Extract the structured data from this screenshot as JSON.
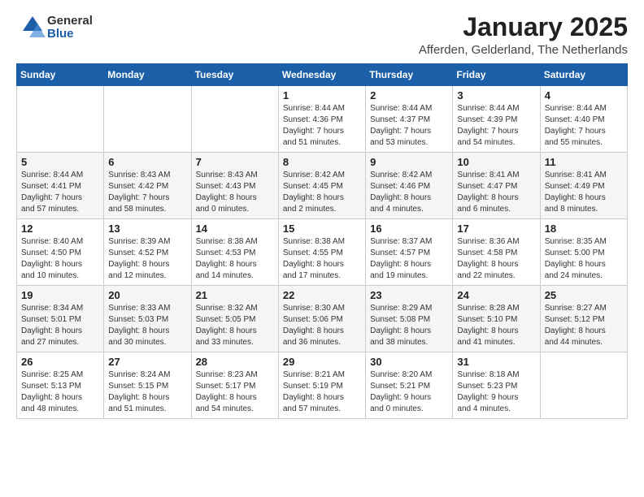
{
  "header": {
    "logo_general": "General",
    "logo_blue": "Blue",
    "title": "January 2025",
    "subtitle": "Afferden, Gelderland, The Netherlands"
  },
  "days_of_week": [
    "Sunday",
    "Monday",
    "Tuesday",
    "Wednesday",
    "Thursday",
    "Friday",
    "Saturday"
  ],
  "weeks": [
    {
      "alt": false,
      "days": [
        {
          "num": "",
          "info": ""
        },
        {
          "num": "",
          "info": ""
        },
        {
          "num": "",
          "info": ""
        },
        {
          "num": "1",
          "info": "Sunrise: 8:44 AM\nSunset: 4:36 PM\nDaylight: 7 hours\nand 51 minutes."
        },
        {
          "num": "2",
          "info": "Sunrise: 8:44 AM\nSunset: 4:37 PM\nDaylight: 7 hours\nand 53 minutes."
        },
        {
          "num": "3",
          "info": "Sunrise: 8:44 AM\nSunset: 4:39 PM\nDaylight: 7 hours\nand 54 minutes."
        },
        {
          "num": "4",
          "info": "Sunrise: 8:44 AM\nSunset: 4:40 PM\nDaylight: 7 hours\nand 55 minutes."
        }
      ]
    },
    {
      "alt": true,
      "days": [
        {
          "num": "5",
          "info": "Sunrise: 8:44 AM\nSunset: 4:41 PM\nDaylight: 7 hours\nand 57 minutes."
        },
        {
          "num": "6",
          "info": "Sunrise: 8:43 AM\nSunset: 4:42 PM\nDaylight: 7 hours\nand 58 minutes."
        },
        {
          "num": "7",
          "info": "Sunrise: 8:43 AM\nSunset: 4:43 PM\nDaylight: 8 hours\nand 0 minutes."
        },
        {
          "num": "8",
          "info": "Sunrise: 8:42 AM\nSunset: 4:45 PM\nDaylight: 8 hours\nand 2 minutes."
        },
        {
          "num": "9",
          "info": "Sunrise: 8:42 AM\nSunset: 4:46 PM\nDaylight: 8 hours\nand 4 minutes."
        },
        {
          "num": "10",
          "info": "Sunrise: 8:41 AM\nSunset: 4:47 PM\nDaylight: 8 hours\nand 6 minutes."
        },
        {
          "num": "11",
          "info": "Sunrise: 8:41 AM\nSunset: 4:49 PM\nDaylight: 8 hours\nand 8 minutes."
        }
      ]
    },
    {
      "alt": false,
      "days": [
        {
          "num": "12",
          "info": "Sunrise: 8:40 AM\nSunset: 4:50 PM\nDaylight: 8 hours\nand 10 minutes."
        },
        {
          "num": "13",
          "info": "Sunrise: 8:39 AM\nSunset: 4:52 PM\nDaylight: 8 hours\nand 12 minutes."
        },
        {
          "num": "14",
          "info": "Sunrise: 8:38 AM\nSunset: 4:53 PM\nDaylight: 8 hours\nand 14 minutes."
        },
        {
          "num": "15",
          "info": "Sunrise: 8:38 AM\nSunset: 4:55 PM\nDaylight: 8 hours\nand 17 minutes."
        },
        {
          "num": "16",
          "info": "Sunrise: 8:37 AM\nSunset: 4:57 PM\nDaylight: 8 hours\nand 19 minutes."
        },
        {
          "num": "17",
          "info": "Sunrise: 8:36 AM\nSunset: 4:58 PM\nDaylight: 8 hours\nand 22 minutes."
        },
        {
          "num": "18",
          "info": "Sunrise: 8:35 AM\nSunset: 5:00 PM\nDaylight: 8 hours\nand 24 minutes."
        }
      ]
    },
    {
      "alt": true,
      "days": [
        {
          "num": "19",
          "info": "Sunrise: 8:34 AM\nSunset: 5:01 PM\nDaylight: 8 hours\nand 27 minutes."
        },
        {
          "num": "20",
          "info": "Sunrise: 8:33 AM\nSunset: 5:03 PM\nDaylight: 8 hours\nand 30 minutes."
        },
        {
          "num": "21",
          "info": "Sunrise: 8:32 AM\nSunset: 5:05 PM\nDaylight: 8 hours\nand 33 minutes."
        },
        {
          "num": "22",
          "info": "Sunrise: 8:30 AM\nSunset: 5:06 PM\nDaylight: 8 hours\nand 36 minutes."
        },
        {
          "num": "23",
          "info": "Sunrise: 8:29 AM\nSunset: 5:08 PM\nDaylight: 8 hours\nand 38 minutes."
        },
        {
          "num": "24",
          "info": "Sunrise: 8:28 AM\nSunset: 5:10 PM\nDaylight: 8 hours\nand 41 minutes."
        },
        {
          "num": "25",
          "info": "Sunrise: 8:27 AM\nSunset: 5:12 PM\nDaylight: 8 hours\nand 44 minutes."
        }
      ]
    },
    {
      "alt": false,
      "days": [
        {
          "num": "26",
          "info": "Sunrise: 8:25 AM\nSunset: 5:13 PM\nDaylight: 8 hours\nand 48 minutes."
        },
        {
          "num": "27",
          "info": "Sunrise: 8:24 AM\nSunset: 5:15 PM\nDaylight: 8 hours\nand 51 minutes."
        },
        {
          "num": "28",
          "info": "Sunrise: 8:23 AM\nSunset: 5:17 PM\nDaylight: 8 hours\nand 54 minutes."
        },
        {
          "num": "29",
          "info": "Sunrise: 8:21 AM\nSunset: 5:19 PM\nDaylight: 8 hours\nand 57 minutes."
        },
        {
          "num": "30",
          "info": "Sunrise: 8:20 AM\nSunset: 5:21 PM\nDaylight: 9 hours\nand 0 minutes."
        },
        {
          "num": "31",
          "info": "Sunrise: 8:18 AM\nSunset: 5:23 PM\nDaylight: 9 hours\nand 4 minutes."
        },
        {
          "num": "",
          "info": ""
        }
      ]
    }
  ]
}
